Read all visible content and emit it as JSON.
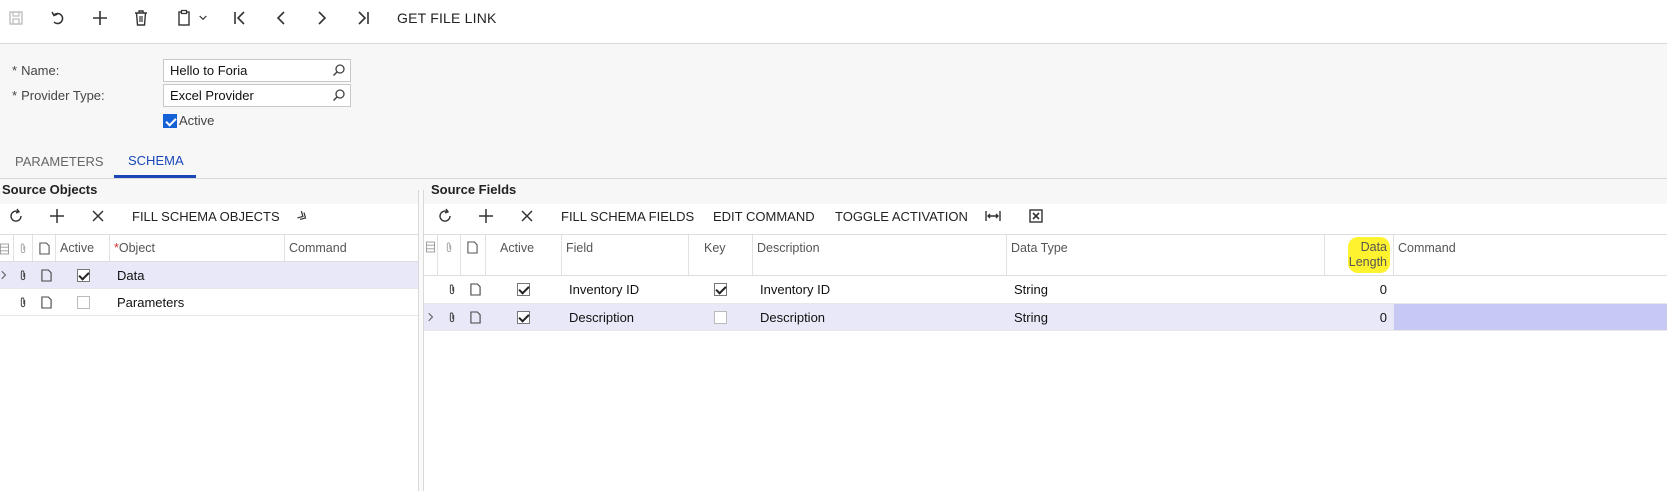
{
  "toolbar": {
    "get_file_link": "GET FILE LINK"
  },
  "form": {
    "name_label": "Name:",
    "name_value": "Hello to Foria",
    "provider_label": "Provider Type:",
    "provider_value": "Excel Provider",
    "active_label": "Active",
    "active_checked": true,
    "required_mark": "*"
  },
  "tabs": [
    {
      "label": "PARAMETERS",
      "active": false
    },
    {
      "label": "SCHEMA",
      "active": true
    }
  ],
  "source_objects": {
    "title": "Source Objects",
    "fill_button": "FILL SCHEMA OBJECTS",
    "columns": {
      "active": "Active",
      "object": "Object",
      "command": "Command",
      "required_mark": "*"
    },
    "rows": [
      {
        "active": true,
        "object": "Data",
        "command": "",
        "selected": true
      },
      {
        "active": false,
        "object": "Parameters",
        "command": "",
        "selected": false
      }
    ]
  },
  "source_fields": {
    "title": "Source Fields",
    "buttons": {
      "fill": "FILL SCHEMA FIELDS",
      "edit": "EDIT COMMAND",
      "toggle": "TOGGLE ACTIVATION"
    },
    "columns": {
      "active": "Active",
      "field": "Field",
      "key": "Key",
      "description": "Description",
      "data_type": "Data Type",
      "data_length_1": "Data",
      "data_length_2": "Length",
      "command": "Command"
    },
    "rows": [
      {
        "active": true,
        "field": "Inventory ID",
        "key": true,
        "description": "Inventory ID",
        "data_type": "String",
        "data_length": "0",
        "command": "",
        "selected": false
      },
      {
        "active": true,
        "field": "Description",
        "key": false,
        "description": "Description",
        "data_type": "String",
        "data_length": "0",
        "command": "",
        "selected": true
      }
    ]
  },
  "colors": {
    "accent": "#1a47b8",
    "selected_row": "#e8e8f8",
    "highlight": "#fff22e",
    "command_selected": "#c8c8f4"
  }
}
